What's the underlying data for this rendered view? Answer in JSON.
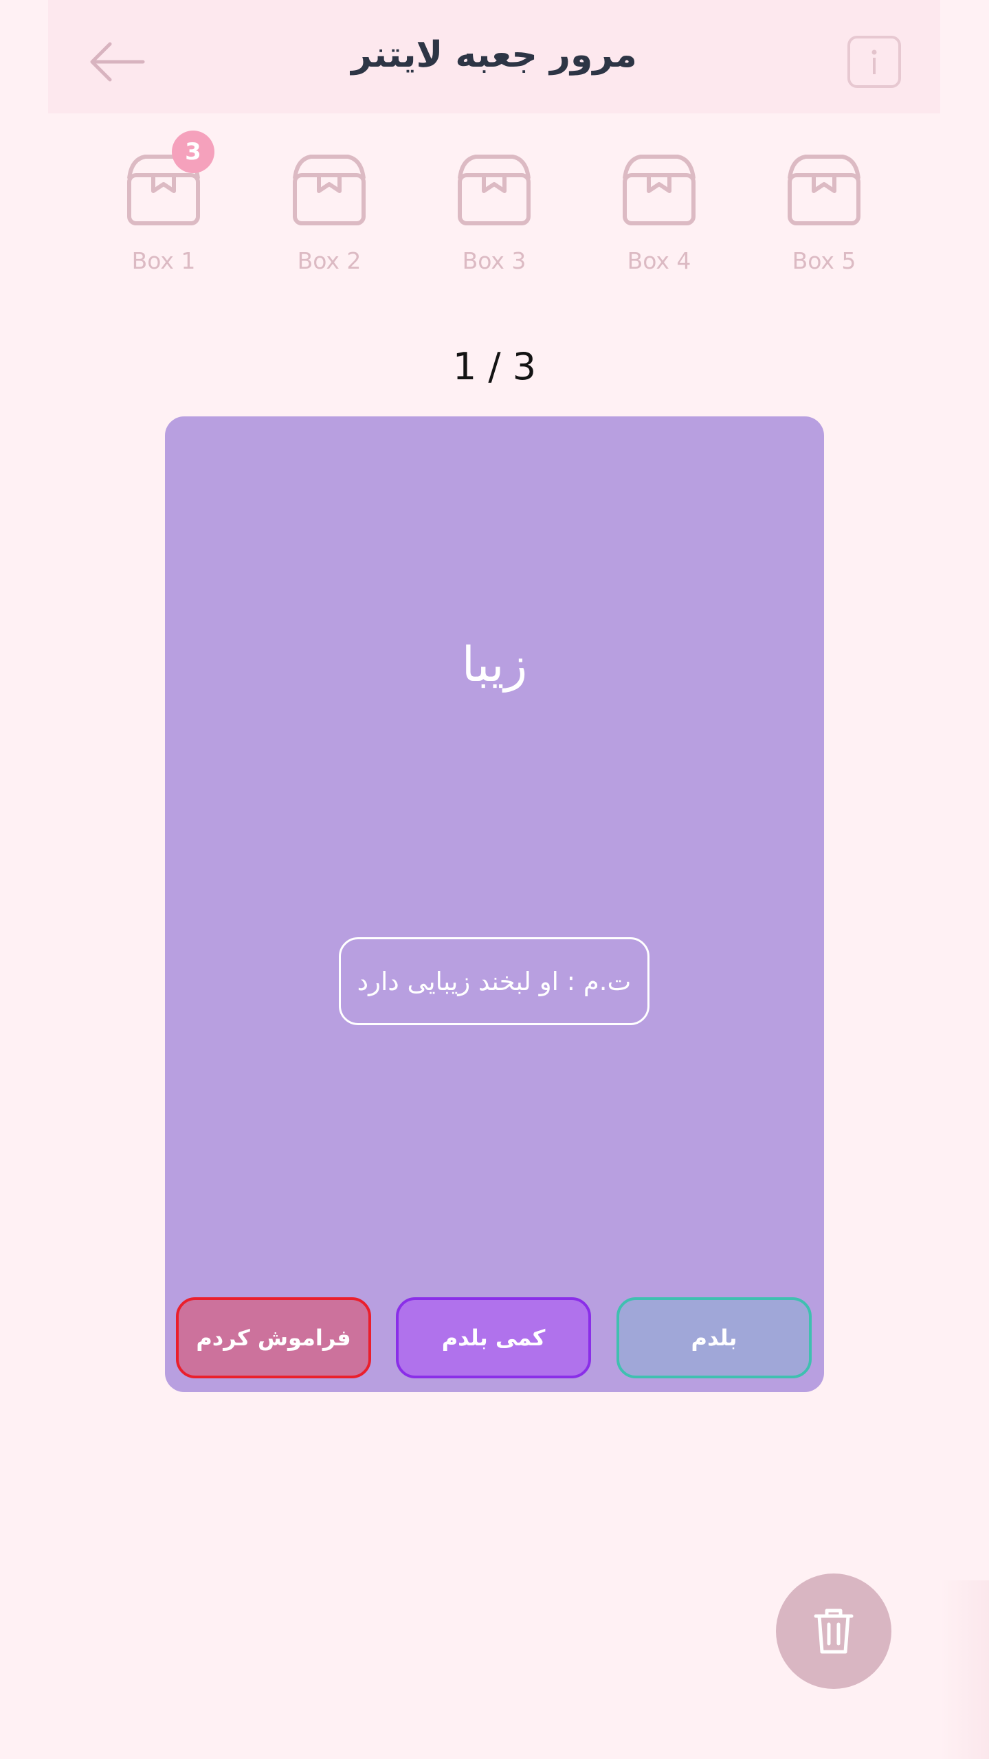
{
  "header": {
    "title": "مرور جعبه لایتنر",
    "back_icon": "arrow-left-icon",
    "info_icon": "info-icon"
  },
  "boxes": [
    {
      "label": "Box 1",
      "badge": "3"
    },
    {
      "label": "Box 2"
    },
    {
      "label": "Box 3"
    },
    {
      "label": "Box 4"
    },
    {
      "label": "Box 5"
    }
  ],
  "counter": "1 / 3",
  "card": {
    "word": "زیبا",
    "example": "ت.م : او لبخند زیبایی دارد",
    "color": "#b89fe0"
  },
  "answers": {
    "forgot": "فراموش کردم",
    "little": "کمی بلدم",
    "know": "بلدم"
  },
  "fab": {
    "icon": "trash-icon"
  },
  "colors": {
    "background": "#fff1f4",
    "header": "#fde8ee",
    "badge": "#f5a1bc",
    "icon": "#dcbac3"
  }
}
